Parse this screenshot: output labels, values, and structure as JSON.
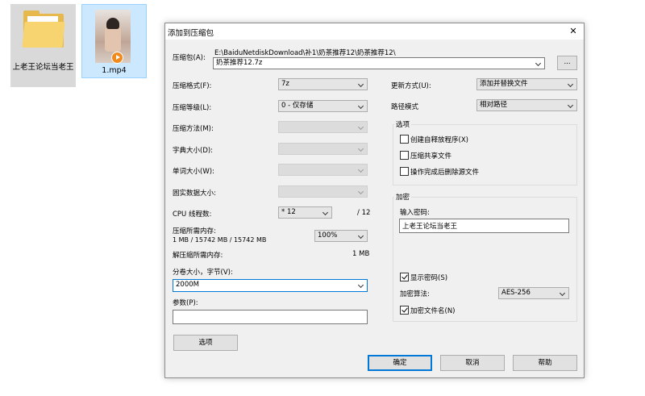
{
  "desktop": {
    "folder_label": "上老王论坛当老王",
    "video_label": "1.mp4"
  },
  "dialog": {
    "title": "添加到压缩包",
    "archive_label": "压缩包(A):",
    "archive_path": "E:\\BaiduNetdiskDownload\\补1\\奶茶推荐12\\奶茶推荐12\\",
    "archive_name": "奶茶推荐12.7z",
    "browse_label": "...",
    "format_label": "压缩格式(F):",
    "format_value": "7z",
    "level_label": "压缩等级(L):",
    "level_value": "0 - 仅存储",
    "method_label": "压缩方法(M):",
    "dict_label": "字典大小(D):",
    "word_label": "单词大小(W):",
    "solid_label": "固实数据大小:",
    "cpu_label": "CPU 线程数:",
    "cpu_value": "* 12",
    "cpu_total": "/ 12",
    "mem_comp_label": "压缩所需内存:",
    "mem_comp_value": "1 MB / 15742 MB / 15742 MB",
    "mem_comp_percent": "100%",
    "mem_decomp_label": "解压缩所需内存:",
    "mem_decomp_value": "1 MB",
    "split_label": "分卷大小，字节(V):",
    "split_value": "2000M",
    "params_label": "参数(P):",
    "params_value": "",
    "options_button": "选项",
    "update_label": "更新方式(U):",
    "update_value": "添加并替换文件",
    "path_label": "路径模式",
    "path_value": "相对路径",
    "options_group": "选项",
    "opt_sfx": "创建自释放程序(X)",
    "opt_shared": "压缩共享文件",
    "opt_delete": "操作完成后删除源文件",
    "encrypt_group": "加密",
    "password_label": "输入密码:",
    "password_value": "上老王论坛当老王",
    "show_password": "显示密码(S)",
    "enc_method_label": "加密算法:",
    "enc_method_value": "AES-256",
    "encrypt_names": "加密文件名(N)",
    "ok": "确定",
    "cancel": "取消",
    "help": "帮助"
  }
}
